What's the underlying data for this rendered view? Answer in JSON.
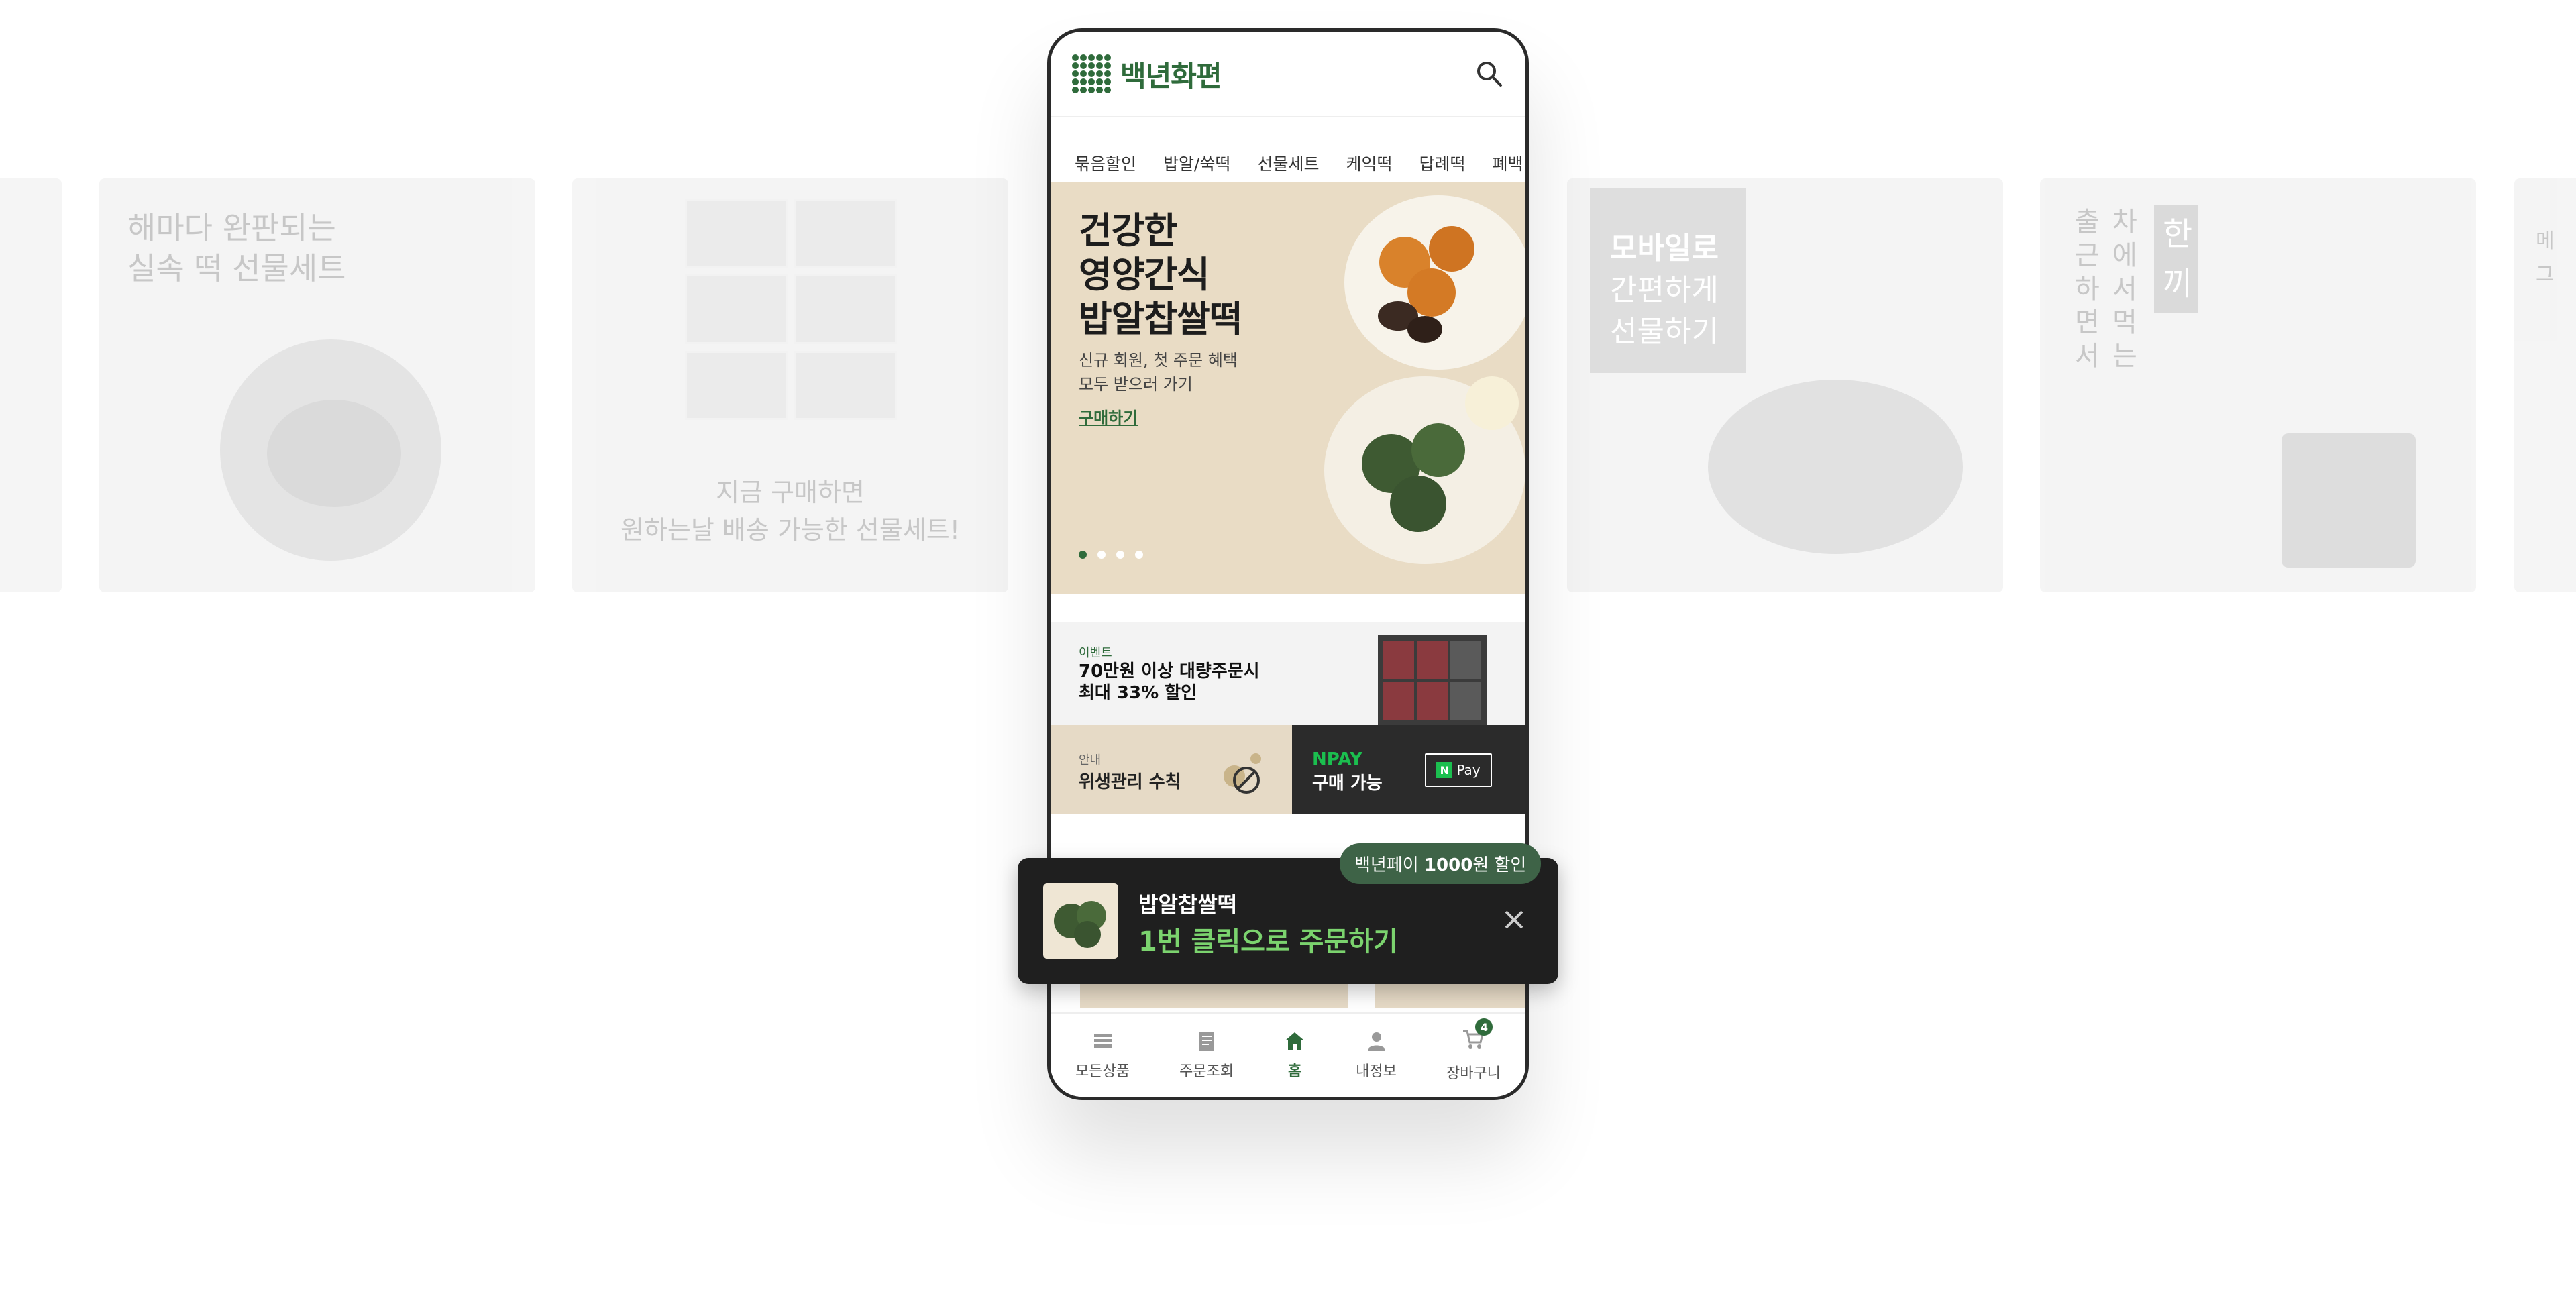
{
  "background_cards": {
    "card1_title": "해마다 완판되는\n실속 떡 선물세트",
    "card2_caption": "지금 구매하면\n원하는날 배송 가능한 선물세트!",
    "card3_title": [
      "모바일로",
      "간편하게",
      "선물하기"
    ],
    "card4_col1": "출근하면서",
    "card4_col2": "차에서 먹는",
    "card4_col3": "한끼",
    "card5_partial": [
      "메",
      "그"
    ]
  },
  "header": {
    "logo_text": "백년화편"
  },
  "tabs": [
    "묶음할인",
    "밥알/쑥떡",
    "선물세트",
    "케익떡",
    "답례떡",
    "폐백"
  ],
  "hero": {
    "title_lines": [
      "건강한",
      "영양간식",
      "밥알찹쌀떡"
    ],
    "subtitle_lines": [
      "신규 회원, 첫 주문 혜택",
      "모두 받으러 가기"
    ],
    "link": "구매하기",
    "slides_count": 4,
    "active_slide": 1
  },
  "event": {
    "tag": "이벤트",
    "title_line1": "70만원 이상 대량주문시",
    "title_line2": "최대 33% 할인"
  },
  "info": {
    "tag": "안내",
    "title": "위생관리 수칙"
  },
  "npay": {
    "tag": "NPAY",
    "title": "구매 가능",
    "badge_n": "N",
    "badge_text": "Pay"
  },
  "toast": {
    "badge_prefix": "백년페이 ",
    "badge_amount": "1000",
    "badge_suffix": "원 할인",
    "product_name": "밥알찹쌀떡",
    "cta": "1번 클릭으로 주문하기"
  },
  "bottom_nav": {
    "items": [
      {
        "label": "모든상품",
        "icon": "list-icon"
      },
      {
        "label": "주문조회",
        "icon": "document-icon"
      },
      {
        "label": "홈",
        "icon": "home-icon",
        "active": true
      },
      {
        "label": "내정보",
        "icon": "person-icon"
      },
      {
        "label": "장바구니",
        "icon": "cart-icon"
      }
    ],
    "cart_count": "4"
  },
  "colors": {
    "brand_green": "#2f6b3b",
    "hero_bg": "#e9dcc5",
    "npay_green": "#1bbf4f",
    "toast_bg": "#1f1f1f",
    "toast_cta": "#7bd36e"
  }
}
